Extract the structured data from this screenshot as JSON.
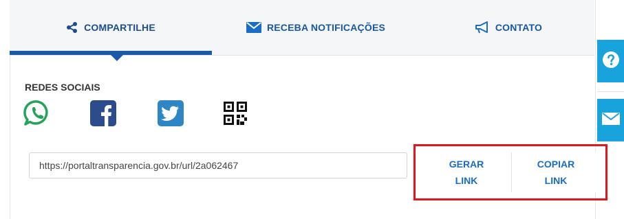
{
  "tabs": [
    {
      "label": "COMPARTILHE",
      "icon": "share-icon",
      "active": true
    },
    {
      "label": "RECEBA NOTIFICAÇÕES",
      "icon": "envelope-icon",
      "active": false
    },
    {
      "label": "CONTATO",
      "icon": "megaphone-icon",
      "active": false
    }
  ],
  "social": {
    "title": "REDES SOCIAIS",
    "items": [
      {
        "icon": "whatsapp-icon",
        "color": "#25a35a"
      },
      {
        "icon": "facebook-icon",
        "color": "#2d4c8d"
      },
      {
        "icon": "twitter-icon",
        "color": "#2f86c5"
      },
      {
        "icon": "qr-code-icon",
        "color": "#111111"
      }
    ]
  },
  "link": {
    "url": "https://portaltransparencia.gov.br/url/2a062467",
    "generate_label": "GERAR LINK",
    "copy_label": "COPIAR LINK"
  },
  "side_buttons": [
    {
      "icon": "help-icon"
    },
    {
      "icon": "envelope-icon"
    }
  ],
  "colors": {
    "accent": "#1a5aa6",
    "side_button": "#19a3dc",
    "highlight": "#e3151a"
  }
}
